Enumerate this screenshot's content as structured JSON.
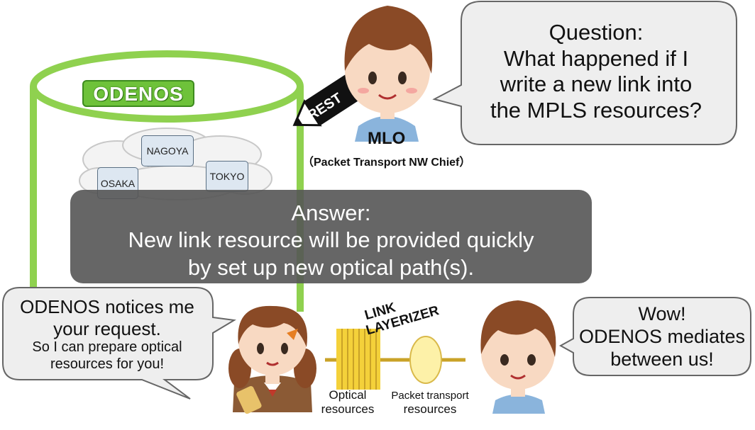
{
  "question": {
    "line1": "Question:",
    "line2": "What happened if I",
    "line3": "write a new link into",
    "line4": "the MPLS resources?"
  },
  "mlo": {
    "name": "MLO",
    "role": "（Packet Transport NW Chief）"
  },
  "odenos": {
    "label": "ODENOS"
  },
  "rest_label": "REST",
  "cities": [
    "NAGOYA",
    "OSAKA",
    "TOKYO"
  ],
  "answer": {
    "line1": "Answer:",
    "line2": "New link resource will be provided quickly",
    "line3": "by set up new optical path(s)."
  },
  "notice": {
    "line1": "ODENOS notices me",
    "line2": "your request.",
    "line3": "So I can prepare optical",
    "line4": "resources for you!"
  },
  "link_layerizer": {
    "line1": "LINK",
    "line2": "LAYERIZER"
  },
  "optical": {
    "line1": "Optical",
    "line2": "resources"
  },
  "packet": {
    "line1": "Packet transport",
    "line2": "resources"
  },
  "wow": {
    "line1": "Wow!",
    "line2": "ODENOS mediates",
    "line3": "between us!"
  },
  "colors": {
    "odenos_green": "#8fd14f",
    "bubble_fill": "#eeeeee",
    "answer_fill": "#555555",
    "link_gold": "#c9a227"
  }
}
